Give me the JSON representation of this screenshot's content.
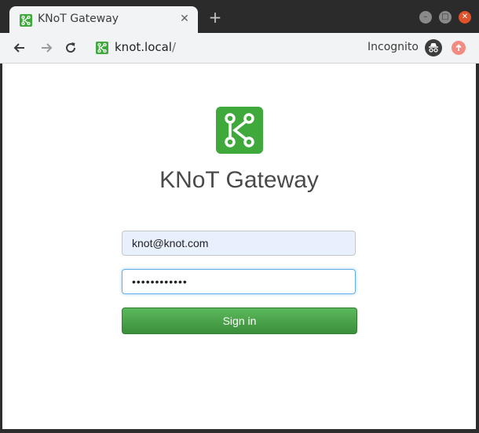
{
  "browser": {
    "tab": {
      "title": "KNoT Gateway",
      "close": "✕"
    },
    "new_tab": "+",
    "address": {
      "host": "knot.local",
      "path": "/"
    },
    "incognito_label": "Incognito"
  },
  "page": {
    "title": "KNoT Gateway",
    "email_value": "knot@knot.com",
    "password_value": "••••••••••••",
    "signin_label": "Sign in"
  },
  "colors": {
    "brand_green": "#3fa93b",
    "button_green": "#4cae4c",
    "close_red": "#e0522a"
  }
}
